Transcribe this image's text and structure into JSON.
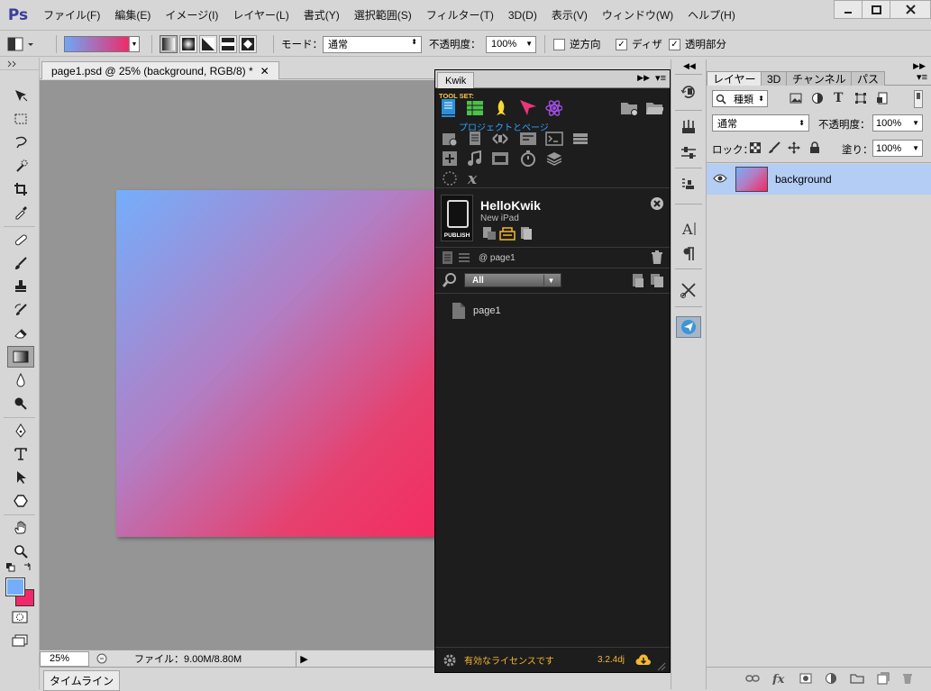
{
  "app": {
    "logo": "Ps",
    "menu": [
      "ファイル(F)",
      "編集(E)",
      "イメージ(I)",
      "レイヤー(L)",
      "書式(Y)",
      "選択範囲(S)",
      "フィルター(T)",
      "3D(D)",
      "表示(V)",
      "ウィンドウ(W)",
      "ヘルプ(H)"
    ]
  },
  "options": {
    "mode_label": "モード：",
    "mode_value": "通常",
    "opacity_label": "不透明度：",
    "opacity_value": "100%",
    "reverse_label": "逆方向",
    "dither_label": "ディザ",
    "transparency_label": "透明部分",
    "reverse_checked": false,
    "dither_checked": true,
    "transparency_checked": true
  },
  "document": {
    "tab_title": "page1.psd @ 25% (background, RGB/8) *",
    "zoom": "25%",
    "file_info": "ファイル：9.00M/8.80M",
    "timeline_tab": "タイムライン",
    "gradient_start": "#74aefb",
    "gradient_end": "#f8275f"
  },
  "kwik": {
    "tab": "Kwik",
    "toolset_label": "TOOL SET:",
    "toolset_tooltip": "プロジェクトとページ",
    "project_name": "HelloKwik",
    "device": "New iPad",
    "publish_label": "PUBLISH",
    "page_ref": "@ page1",
    "filter_value": "All",
    "pages": [
      "page1"
    ],
    "license": "有効なライセンスです",
    "version": "3.2.4dj",
    "accent": "#f5b82f"
  },
  "layers": {
    "tabs": [
      "レイヤー",
      "3D",
      "チャンネル",
      "パス"
    ],
    "kind_filter": "種類",
    "blend_mode": "通常",
    "opacity_label": "不透明度：",
    "opacity_value": "100%",
    "lock_label": "ロック：",
    "fill_label": "塗り：",
    "fill_value": "100%",
    "items": [
      {
        "name": "background",
        "visible": true,
        "selected": true
      }
    ]
  }
}
